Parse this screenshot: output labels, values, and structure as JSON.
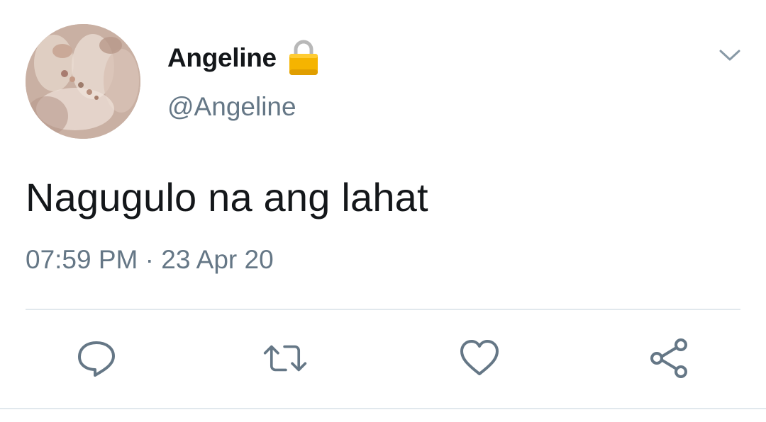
{
  "user": {
    "display_name": "Angeline",
    "handle": "@Angeline",
    "protected_icon": "lock-icon",
    "avatar_icon": "profile-photo"
  },
  "tweet": {
    "text": "Nagugulo na ang lahat",
    "time": "07:59 PM",
    "separator": "·",
    "date": "23 Apr 20"
  },
  "menu": {
    "icon": "chevron-down-icon"
  },
  "actions": [
    {
      "name": "reply",
      "icon": "reply-icon"
    },
    {
      "name": "retweet",
      "icon": "retweet-icon"
    },
    {
      "name": "like",
      "icon": "heart-icon"
    },
    {
      "name": "share",
      "icon": "share-icon"
    }
  ],
  "colors": {
    "text_primary": "#14171a",
    "text_secondary": "#657786",
    "icon": "#657786",
    "divider": "#e1e8ed",
    "lock_body": "#f5b400",
    "lock_shackle": "#b8b8b8"
  }
}
